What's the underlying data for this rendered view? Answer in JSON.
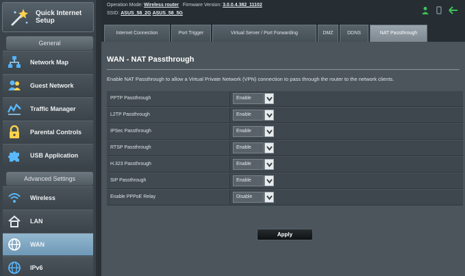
{
  "sidebar": {
    "quick_setup": "Quick Internet Setup",
    "general_header": "General",
    "general_items": [
      {
        "label": "Network Map",
        "icon": "network-map-icon"
      },
      {
        "label": "Guest Network",
        "icon": "guest-network-icon"
      },
      {
        "label": "Traffic Manager",
        "icon": "traffic-manager-icon"
      },
      {
        "label": "Parental Controls",
        "icon": "parental-controls-icon"
      },
      {
        "label": "USB Application",
        "icon": "usb-application-icon"
      }
    ],
    "advanced_header": "Advanced Settings",
    "advanced_items": [
      {
        "label": "Wireless",
        "icon": "wireless-icon"
      },
      {
        "label": "LAN",
        "icon": "lan-icon"
      },
      {
        "label": "WAN",
        "icon": "wan-icon",
        "active": true
      },
      {
        "label": "IPv6",
        "icon": "ipv6-icon"
      }
    ]
  },
  "header": {
    "operation_mode_label": "Operation Mode:",
    "operation_mode_value": "Wireless router",
    "firmware_label": "Firmware Version:",
    "firmware_value": "3.0.0.4.382_11102",
    "ssid_label": "SSID:",
    "ssid_1": "ASUS_58_2G",
    "ssid_2": "ASUS_58_5G"
  },
  "tabs": [
    {
      "label": "Internet Connection"
    },
    {
      "label": "Port Trigger"
    },
    {
      "label": "Virtual Server / Port Forwarding"
    },
    {
      "label": "DMZ"
    },
    {
      "label": "DDNS"
    },
    {
      "label": "NAT Passthrough",
      "active": true
    }
  ],
  "page": {
    "title": "WAN - NAT Passthrough",
    "description": "Enable NAT Passthrough to allow a Virtual Private Network (VPN) connection to pass through the router to the network clients.",
    "apply_label": "Apply"
  },
  "fields": [
    {
      "label": "PPTP Passthrough",
      "value": "Enable"
    },
    {
      "label": "L2TP Passthrough",
      "value": "Enable"
    },
    {
      "label": "IPSec Passthrough",
      "value": "Enable"
    },
    {
      "label": "RTSP Passthrough",
      "value": "Enable"
    },
    {
      "label": "H.323 Passthrough",
      "value": "Enable"
    },
    {
      "label": "SIP Passthrough",
      "value": "Enable"
    },
    {
      "label": "Enable PPPoE Relay",
      "value": "Disable"
    }
  ],
  "colors": {
    "background": "#2a3238",
    "sidebar": "#3a4349",
    "content": "#4b555b",
    "active_item": "#7fa6c1",
    "status_green": "#3ec25a"
  }
}
